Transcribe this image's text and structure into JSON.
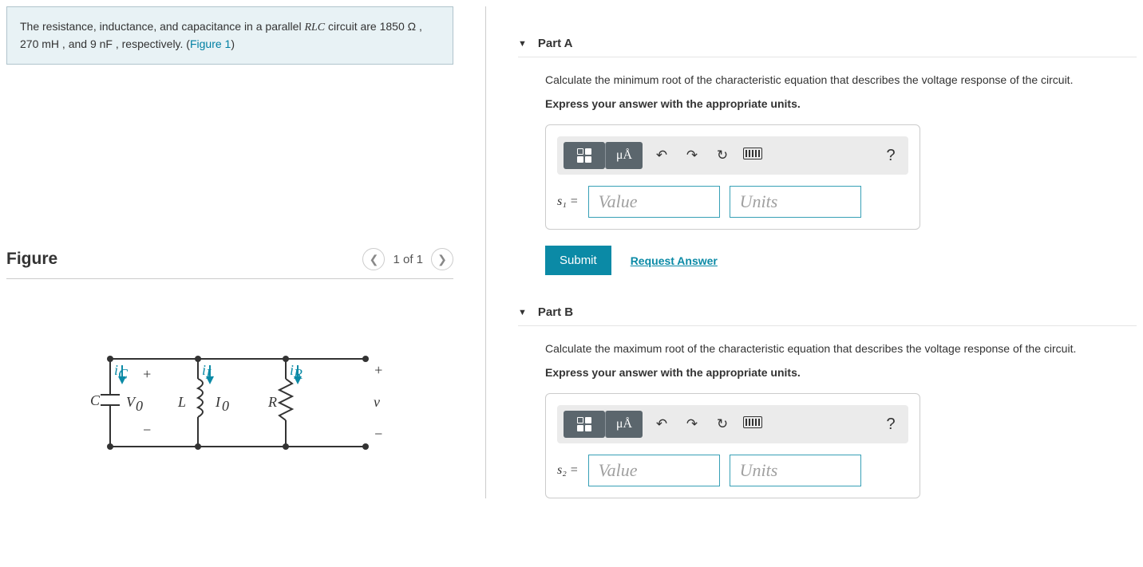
{
  "intro": {
    "prefix": "The resistance, inductance, and capacitance in a parallel ",
    "rlc": "RLC",
    "mid1": " circuit are ",
    "r_val": "1850 Ω",
    "sep1": " , ",
    "l_val": "270 mH",
    "sep2": " , and ",
    "c_val": "9 nF",
    "suffix": " , respectively. (",
    "figlink": "Figure 1",
    "close": ")"
  },
  "figure": {
    "heading": "Figure",
    "pager_label": "1 of 1",
    "circuit_labels": {
      "iC": "iC",
      "iL": "iL",
      "iR": "iR",
      "C": "C",
      "V0": "V0",
      "L": "L",
      "I0": "I0",
      "R": "R",
      "v": "v",
      "plus": "+",
      "minus": "−"
    }
  },
  "partA": {
    "title": "Part A",
    "question": "Calculate the minimum root of the characteristic equation that describes the voltage response of the circuit.",
    "instruction": "Express your answer with the appropriate units.",
    "var": "s₁ =",
    "value_ph": "Value",
    "units_ph": "Units",
    "unit_btn": "μÅ",
    "submit": "Submit",
    "request": "Request Answer"
  },
  "partB": {
    "title": "Part B",
    "question": "Calculate the maximum root of the characteristic equation that describes the voltage response of the circuit.",
    "instruction": "Express your answer with the appropriate units.",
    "var": "s₂ =",
    "value_ph": "Value",
    "units_ph": "Units",
    "unit_btn": "μÅ"
  }
}
